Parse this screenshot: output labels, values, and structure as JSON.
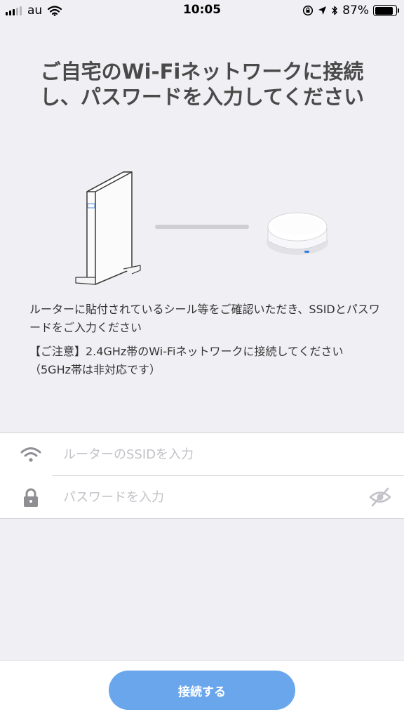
{
  "status_bar": {
    "carrier": "au",
    "time": "10:05",
    "battery": "87%",
    "battery_level": 0.87,
    "icons": [
      "signal-icon",
      "wifi-icon",
      "rotation-lock-icon",
      "location-icon",
      "bluetooth-icon",
      "battery-icon"
    ]
  },
  "title": "ご自宅のWi-Fiネットワークに接続し、パスワードを入力してください",
  "description": {
    "line1": "ルーターに貼付されているシール等をご確認いただき、SSIDとパスワードをご入力ください",
    "line2": "【ご注意】2.4GHz帯のWi-Fiネットワークに接続してください（5GHz帯は非対応です）"
  },
  "form": {
    "ssid_placeholder": "ルーターのSSIDを入力",
    "ssid_value": "",
    "password_placeholder": "パスワードを入力",
    "password_value": ""
  },
  "connect_button": {
    "label": "接続する",
    "color": "#6aa6ec"
  },
  "colors": {
    "background": "#f0f0f4",
    "icon_gray": "#8e8e93",
    "hub_accent": "#2f7de0"
  }
}
